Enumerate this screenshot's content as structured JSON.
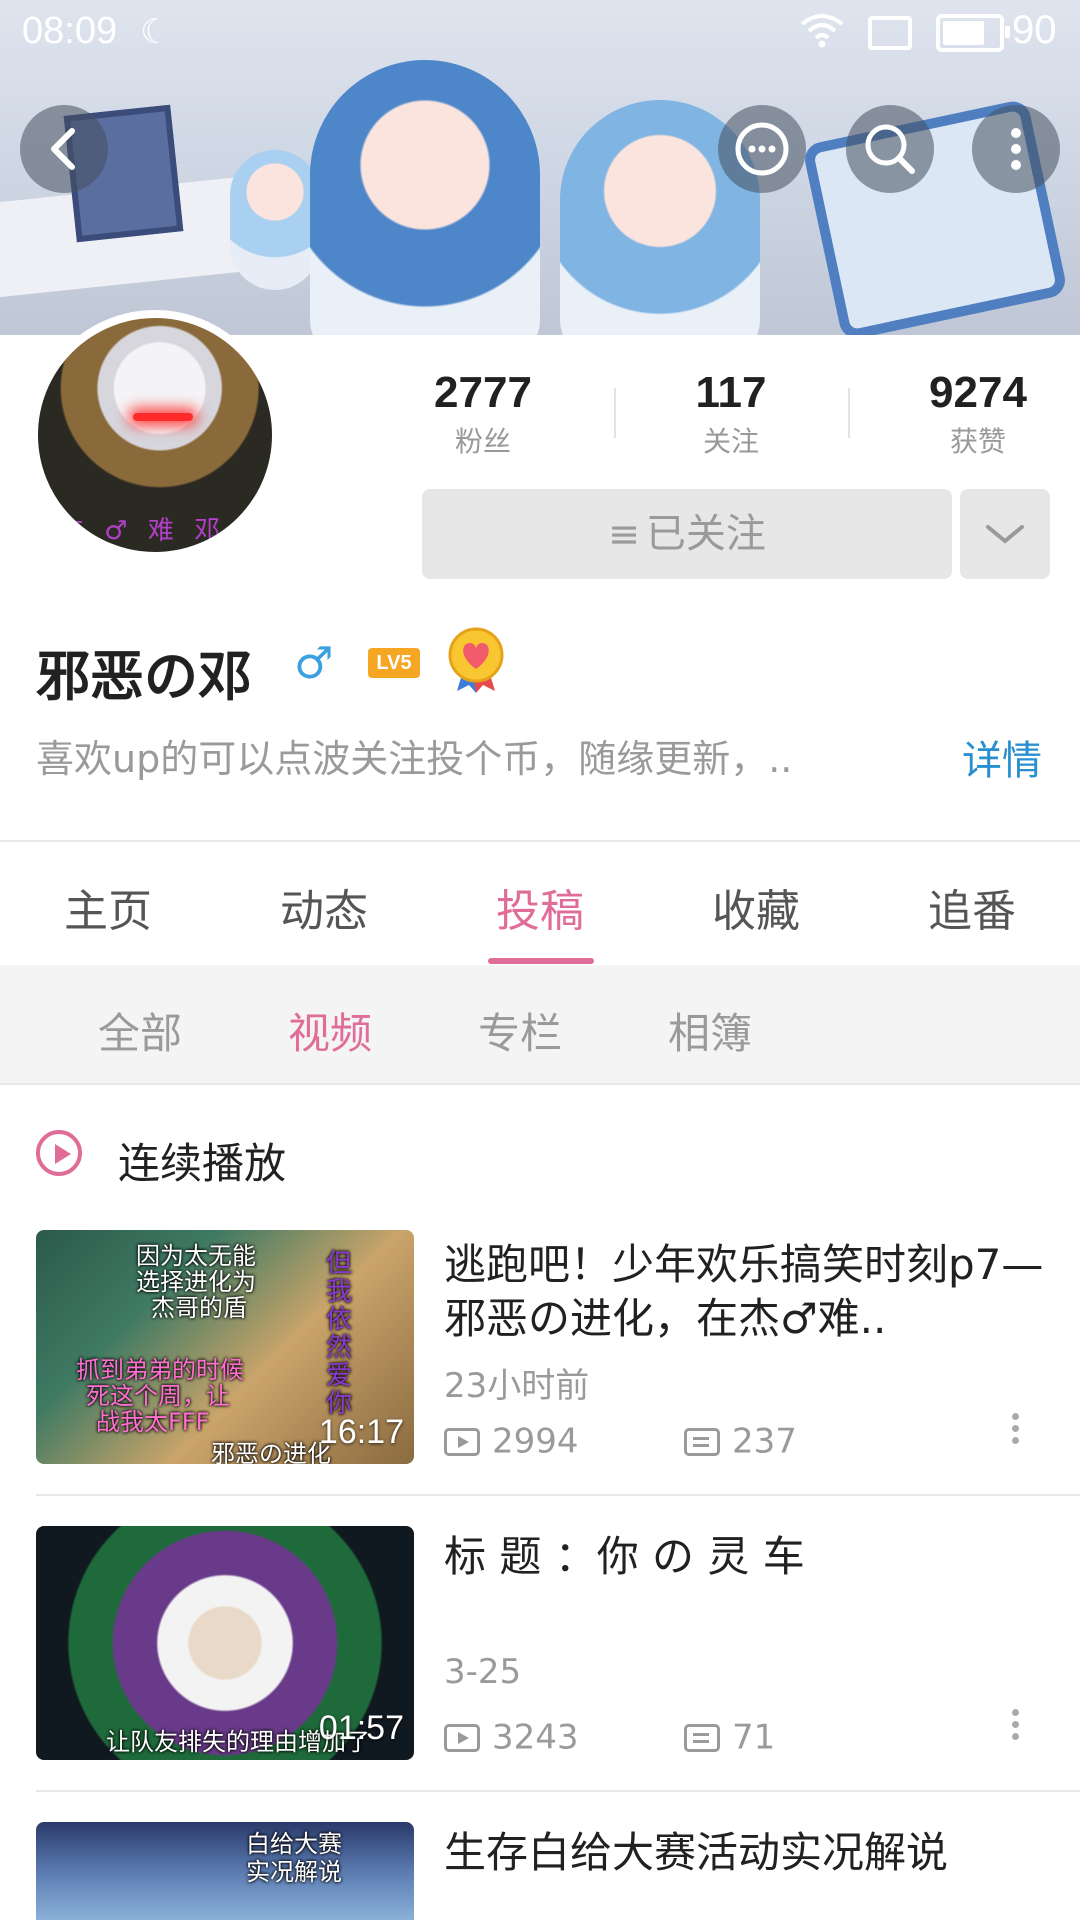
{
  "status_bar": {
    "time": "08:09",
    "battery": "90",
    "battery_level": 0.9
  },
  "profile": {
    "name": "邪恶の邓",
    "gender_symbol": "♂",
    "level": "LV5",
    "avatar_text": "杰 ♂ 难 邓",
    "bio": "喜欢up的可以点波关注投个币，随缘更新，..",
    "detail_link": "详情"
  },
  "stats": [
    {
      "value": "2777",
      "label": "粉丝"
    },
    {
      "value": "117",
      "label": "关注"
    },
    {
      "value": "9274",
      "label": "获赞"
    }
  ],
  "follow_button": {
    "icon": "≡",
    "label": "已关注"
  },
  "tabs": [
    "主页",
    "动态",
    "投稿",
    "收藏",
    "追番"
  ],
  "active_tab": "投稿",
  "subtabs": [
    "全部",
    "视频",
    "专栏",
    "相簿"
  ],
  "active_subtab": "视频",
  "continuous_play": "连续播放",
  "videos": [
    {
      "title": "逃跑吧！少年欢乐搞笑时刻p7—邪恶の进化，在杰♂难..",
      "date": "23小时前",
      "plays": "2994",
      "danmaku": "237",
      "duration": "16:17",
      "thumb_captions": [
        "因为太无能",
        "选择进化为",
        "杰哥的盾",
        "但我依然爱你",
        "抓到弟弟的时候",
        "死这个周，让",
        "战我太FFF",
        "邪恶の进化"
      ]
    },
    {
      "title": "标 题 ：你 の 灵 车",
      "date": "3-25",
      "plays": "3243",
      "danmaku": "71",
      "duration": "01:57",
      "thumb_captions": [
        "让队友排失的理由增加了"
      ]
    },
    {
      "title": "生存白给大赛活动实况解说",
      "thumb_captions": [
        "白给大赛",
        "实况解说"
      ]
    }
  ],
  "icons": {
    "back": "chevron-left-icon",
    "message": "chat-bubble-icon",
    "search": "search-icon",
    "more": "more-vertical-icon"
  },
  "colors": {
    "accent": "#e06d98",
    "link": "#2a8fd0",
    "level": "#f5a623"
  }
}
